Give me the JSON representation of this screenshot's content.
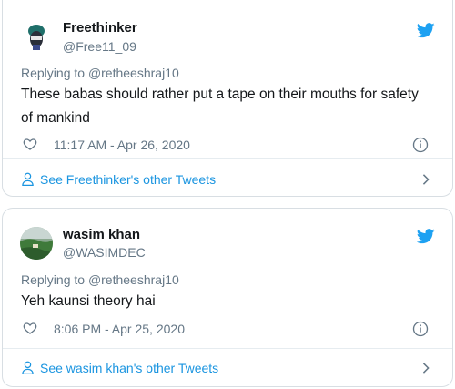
{
  "tweets": [
    {
      "name": "Freethinker",
      "handle": "@Free11_09",
      "reply_prefix": "Replying to ",
      "reply_to": "@retheeshraj10",
      "text": "These babas should rather put a tape on their mouths for safety of mankind",
      "timestamp": "11:17 AM - Apr 26, 2020",
      "see_more": "See Freethinker's other Tweets",
      "icons": [
        "twitter-bird-icon",
        "heart-icon",
        "info-icon",
        "user-icon",
        "chevron-right-icon"
      ]
    },
    {
      "name": "wasim khan",
      "handle": "@WASIMDEC",
      "reply_prefix": "Replying to ",
      "reply_to": "@retheeshraj10",
      "text": "Yeh kaunsi theory hai",
      "timestamp": "8:06 PM - Apr 25, 2020",
      "see_more": "See wasim khan's other Tweets",
      "icons": [
        "twitter-bird-icon",
        "heart-icon",
        "info-icon",
        "user-icon",
        "chevron-right-icon"
      ]
    }
  ],
  "colors": {
    "accent": "#1da1f2",
    "link": "#1b95e0",
    "muted": "#657786",
    "text": "#14171a",
    "border": "#d8dee3"
  }
}
